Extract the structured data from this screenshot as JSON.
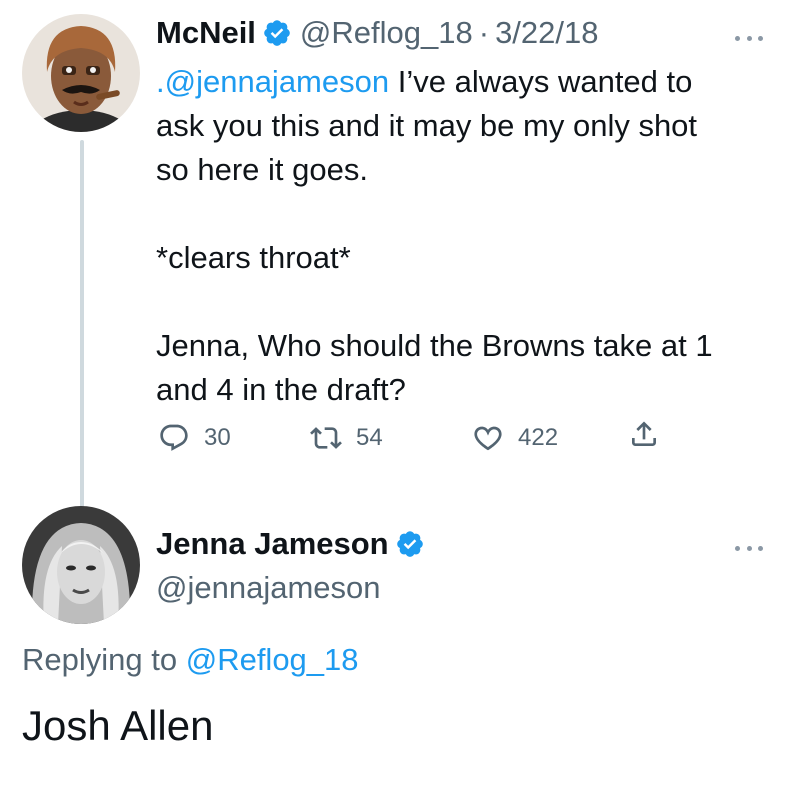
{
  "original_tweet": {
    "author_name": "McNeil",
    "handle": "@Reflog_18",
    "separator": "·",
    "date": "3/22/18",
    "text": {
      "mention": ".@jennajameson",
      "line1_rest": " I’ve always wanted to",
      "line2": "ask you this and it may be my only shot",
      "line3": "so here it goes.",
      "line4": "*clears throat*",
      "line5": "Jenna, Who should the Browns take at 1",
      "line6": "and 4 in the draft?"
    },
    "stats": {
      "replies": "30",
      "retweets": "54",
      "likes": "422"
    },
    "avatar_icon": "user-avatar",
    "verified_icon": "verified-badge-icon"
  },
  "reply_tweet": {
    "author_name": "Jenna Jameson",
    "handle": "@jennajameson",
    "replying_prefix": "Replying to",
    "replying_to": "@Reflog_18",
    "text": "Josh Allen",
    "avatar_icon": "user-avatar",
    "verified_icon": "verified-badge-icon"
  },
  "colors": {
    "accent": "#1d9bf0",
    "text": "#0f1419",
    "muted": "#536471",
    "thread_line": "#cfd9de"
  }
}
